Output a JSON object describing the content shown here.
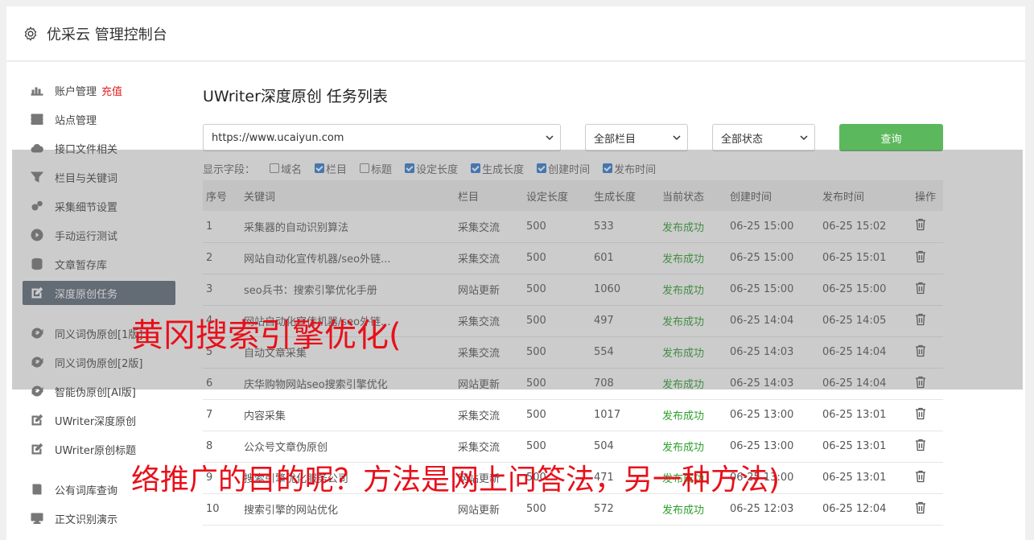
{
  "header": {
    "title": "优采云 管理控制台"
  },
  "sidebar": {
    "items": [
      {
        "label": "账户管理",
        "badge": "充值",
        "icon": "bar-chart-icon"
      },
      {
        "label": "站点管理",
        "icon": "server-icon"
      },
      {
        "label": "接口文件相关",
        "icon": "cloud-upload-icon"
      },
      {
        "label": "栏目与关键词",
        "icon": "filter-icon"
      },
      {
        "label": "采集细节设置",
        "icon": "gears-icon"
      },
      {
        "label": "手动运行测试",
        "icon": "play-icon"
      },
      {
        "label": "文章暂存库",
        "icon": "database-icon"
      },
      {
        "label": "深度原创任务",
        "icon": "edit-icon",
        "active": true
      },
      {
        "label": "同义词伪原创[1版]",
        "icon": "refresh-icon"
      },
      {
        "label": "同义词伪原创[2版]",
        "icon": "refresh-icon"
      },
      {
        "label": "智能伪原创[AI版]",
        "icon": "refresh-icon"
      },
      {
        "label": "UWriter深度原创",
        "icon": "edit-icon"
      },
      {
        "label": "UWriter原创标题",
        "icon": "edit-icon"
      },
      {
        "label": "公有词库查询",
        "icon": "book-icon"
      },
      {
        "label": "正文识别演示",
        "icon": "monitor-icon"
      }
    ]
  },
  "main": {
    "title": "UWriter深度原创 任务列表",
    "filters": {
      "site": "https://www.ucaiyun.com",
      "column": "全部栏目",
      "status": "全部状态",
      "query_label": "查询"
    },
    "fields": {
      "label": "显示字段：",
      "options": [
        {
          "label": "域名",
          "checked": false
        },
        {
          "label": "栏目",
          "checked": true
        },
        {
          "label": "标题",
          "checked": false
        },
        {
          "label": "设定长度",
          "checked": true
        },
        {
          "label": "生成长度",
          "checked": true
        },
        {
          "label": "创建时间",
          "checked": true
        },
        {
          "label": "发布时间",
          "checked": true
        }
      ]
    },
    "table": {
      "headers": [
        "序号",
        "关键词",
        "栏目",
        "设定长度",
        "生成长度",
        "当前状态",
        "创建时间",
        "发布时间",
        "操作"
      ],
      "rows": [
        [
          "1",
          "采集器的自动识别算法",
          "采集交流",
          "500",
          "533",
          "发布成功",
          "06-25 15:00",
          "06-25 15:02"
        ],
        [
          "2",
          "网站自动化宣传机器/seo外链...",
          "采集交流",
          "500",
          "601",
          "发布成功",
          "06-25 15:00",
          "06-25 15:01"
        ],
        [
          "3",
          "seo兵书：搜索引擎优化手册",
          "网站更新",
          "500",
          "1060",
          "发布成功",
          "06-25 15:00",
          "06-25 15:00"
        ],
        [
          "4",
          "网站自动化宣传机器/seo外链...",
          "采集交流",
          "500",
          "497",
          "发布成功",
          "06-25 14:04",
          "06-25 14:05"
        ],
        [
          "5",
          "自动文章采集",
          "采集交流",
          "500",
          "554",
          "发布成功",
          "06-25 14:03",
          "06-25 14:04"
        ],
        [
          "6",
          "庆华购物网站seo搜索引擎优化",
          "网站更新",
          "500",
          "708",
          "发布成功",
          "06-25 14:03",
          "06-25 14:04"
        ],
        [
          "7",
          "内容采集",
          "采集交流",
          "500",
          "1017",
          "发布成功",
          "06-25 13:00",
          "06-25 13:01"
        ],
        [
          "8",
          "公众号文章伪原创",
          "采集交流",
          "500",
          "504",
          "发布成功",
          "06-25 13:00",
          "06-25 13:01"
        ],
        [
          "9",
          "搜索引擎优化服务公司",
          "网站更新",
          "500",
          "471",
          "发布成功",
          "06-25 13:00",
          "06-25 13:01"
        ],
        [
          "10",
          "搜索引擎的网站优化",
          "网站更新",
          "500",
          "572",
          "发布成功",
          "06-25 12:03",
          "06-25 12:04"
        ]
      ]
    }
  },
  "watermark": {
    "line1": "黄冈搜索引擎优化(",
    "line2": "络推广的目的呢？方法是网上问答法，另一种方法)"
  },
  "colors": {
    "accent_green": "#5cb85c",
    "status_ok": "#2e9e2e",
    "watermark_red": "#e8101a",
    "active_nav": "#5f6b7a"
  }
}
